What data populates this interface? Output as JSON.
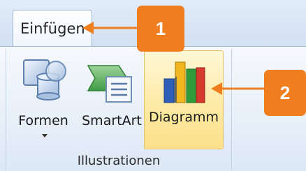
{
  "tab": {
    "label": "Einfügen"
  },
  "group": {
    "label": "Illustrationen",
    "commands": [
      {
        "label": "Formen",
        "icon": "shapes-icon",
        "has_dropdown": true
      },
      {
        "label": "SmartArt",
        "icon": "smartart-icon",
        "has_dropdown": false
      },
      {
        "label": "Diagramm",
        "icon": "chart-icon",
        "has_dropdown": false,
        "highlighted": true
      }
    ]
  },
  "callouts": [
    {
      "number": "1",
      "points_to": "tab"
    },
    {
      "number": "2",
      "points_to": "diagramm-button"
    }
  ],
  "colors": {
    "callout": "#f07e1f",
    "highlight": "#fde9a2"
  }
}
